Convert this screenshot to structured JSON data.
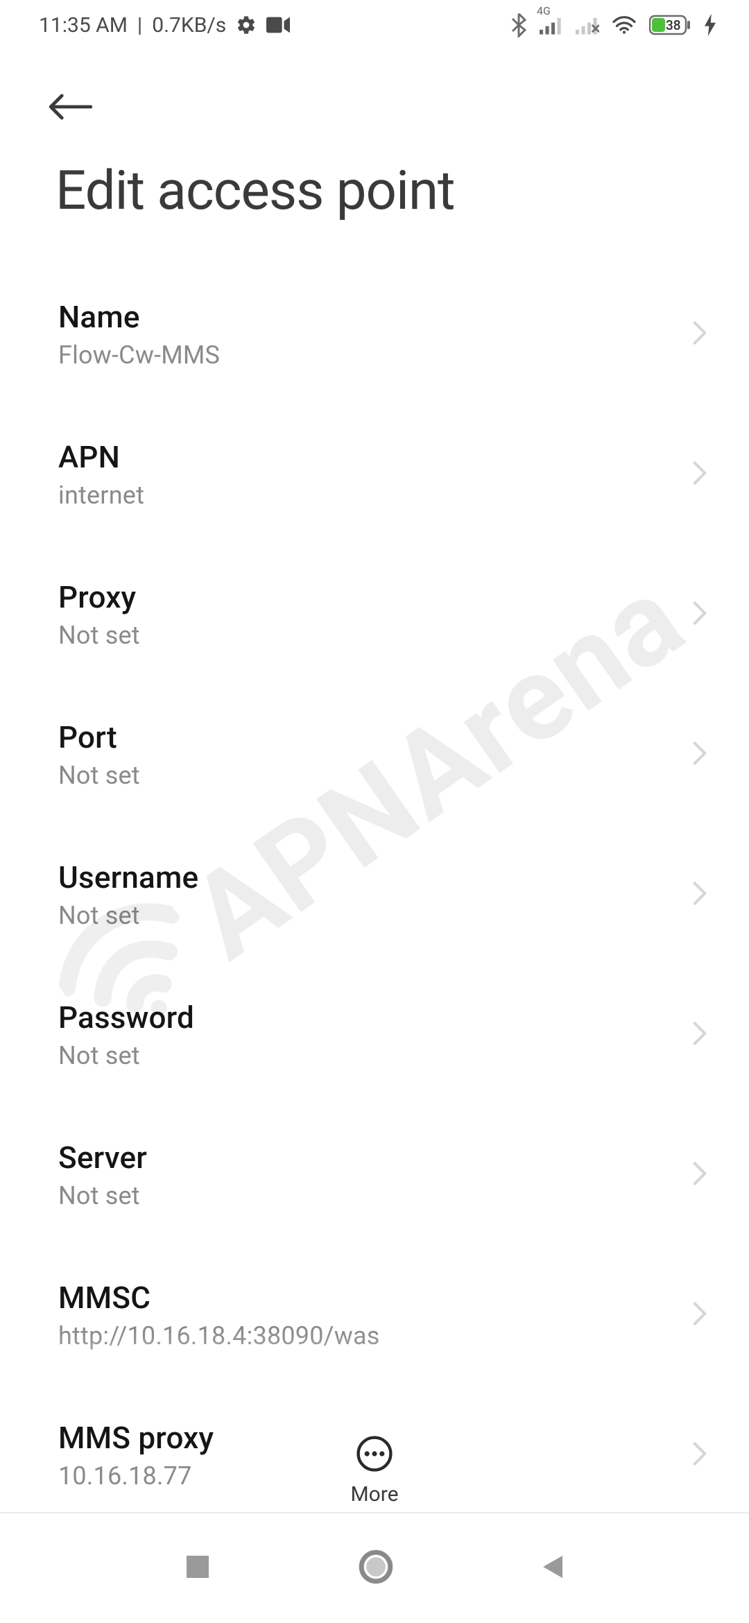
{
  "statusbar": {
    "time": "11:35 AM",
    "net_rate": "0.7KB/s",
    "network_label": "4G",
    "battery_pct": "38"
  },
  "header": {
    "title": "Edit access point"
  },
  "items": [
    {
      "label": "Name",
      "value": "Flow-Cw-MMS"
    },
    {
      "label": "APN",
      "value": "internet"
    },
    {
      "label": "Proxy",
      "value": "Not set"
    },
    {
      "label": "Port",
      "value": "Not set"
    },
    {
      "label": "Username",
      "value": "Not set"
    },
    {
      "label": "Password",
      "value": "Not set"
    },
    {
      "label": "Server",
      "value": "Not set"
    },
    {
      "label": "MMSC",
      "value": "http://10.16.18.4:38090/was"
    },
    {
      "label": "MMS proxy",
      "value": "10.16.18.77"
    }
  ],
  "bottombar": {
    "more_label": "More"
  },
  "watermark": "APNArena"
}
